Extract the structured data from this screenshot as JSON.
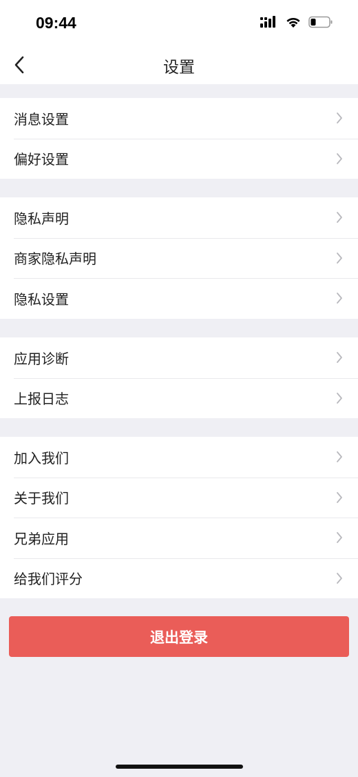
{
  "status_bar": {
    "time": "09:44"
  },
  "nav": {
    "title": "设置"
  },
  "groups": [
    {
      "items": [
        {
          "label": "消息设置"
        },
        {
          "label": "偏好设置"
        }
      ]
    },
    {
      "items": [
        {
          "label": "隐私声明"
        },
        {
          "label": "商家隐私声明"
        },
        {
          "label": "隐私设置"
        }
      ]
    },
    {
      "items": [
        {
          "label": "应用诊断"
        },
        {
          "label": "上报日志"
        }
      ]
    },
    {
      "items": [
        {
          "label": "加入我们"
        },
        {
          "label": "关于我们"
        },
        {
          "label": "兄弟应用"
        },
        {
          "label": "给我们评分"
        }
      ]
    }
  ],
  "logout": {
    "label": "退出登录"
  },
  "colors": {
    "accent": "#ea5d58",
    "background": "#efeff4",
    "chevron": "#b8b8bd"
  },
  "icons": [
    "signal-icon",
    "wifi-icon",
    "battery-icon",
    "back-arrow-icon",
    "chevron-right-icon"
  ]
}
